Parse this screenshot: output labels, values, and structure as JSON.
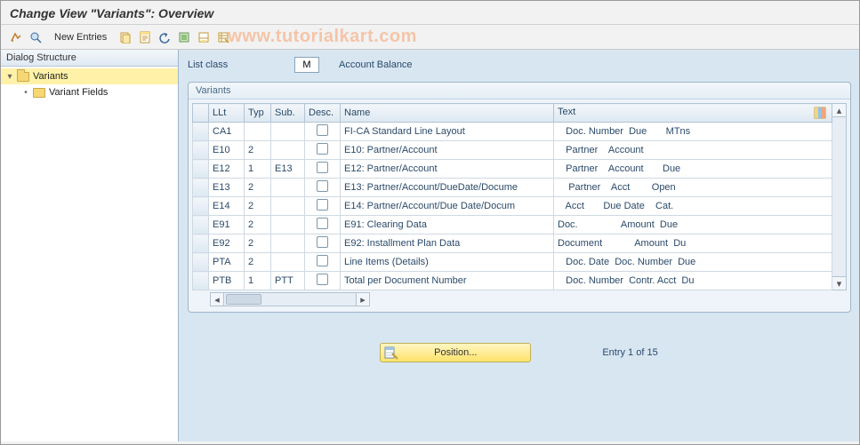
{
  "title": "Change View \"Variants\": Overview",
  "toolbar": {
    "new_entries": "New Entries"
  },
  "watermark": "www.tutorialkart.com",
  "sidebar": {
    "title": "Dialog Structure",
    "items": [
      {
        "label": "Variants",
        "level": 0,
        "expanded": true,
        "selected": true
      },
      {
        "label": "Variant Fields",
        "level": 1,
        "expanded": false,
        "selected": false
      }
    ]
  },
  "header_fields": {
    "list_class_label": "List class",
    "list_class_value": "M",
    "list_class_text": "Account Balance"
  },
  "panel": {
    "title": "Variants",
    "columns": {
      "llt": "LLt",
      "typ": "Typ",
      "sub": "Sub.",
      "desc": "Desc.",
      "name": "Name",
      "text": "Text"
    },
    "rows": [
      {
        "llt": "CA1",
        "typ": "",
        "sub": "",
        "name": "FI-CA Standard Line Layout",
        "text": "   Doc. Number  Due       MTns"
      },
      {
        "llt": "E10",
        "typ": "2",
        "sub": "",
        "name": "E10: Partner/Account",
        "text": "   Partner    Account"
      },
      {
        "llt": "E12",
        "typ": "1",
        "sub": "E13",
        "name": "E12: Partner/Account",
        "text": "   Partner    Account       Due"
      },
      {
        "llt": "E13",
        "typ": "2",
        "sub": "",
        "name": "E13: Partner/Account/DueDate/Docume",
        "text": "    Partner    Acct        Open"
      },
      {
        "llt": "E14",
        "typ": "2",
        "sub": "",
        "name": "E14: Partner/Account/Due Date/Docum",
        "text": "   Acct       Due Date    Cat."
      },
      {
        "llt": "E91",
        "typ": "2",
        "sub": "",
        "name": "E91: Clearing Data",
        "text": "Doc.                Amount  Due"
      },
      {
        "llt": "E92",
        "typ": "2",
        "sub": "",
        "name": "E92: Installment Plan Data",
        "text": "Document            Amount  Du"
      },
      {
        "llt": "PTA",
        "typ": "2",
        "sub": "",
        "name": "Line Items (Details)",
        "text": "   Doc. Date  Doc. Number  Due"
      },
      {
        "llt": "PTB",
        "typ": "1",
        "sub": "PTT",
        "name": "Total per Document Number",
        "text": "   Doc. Number  Contr. Acct  Du"
      }
    ]
  },
  "footer": {
    "position_button": "Position...",
    "entry_text": "Entry 1 of 15"
  }
}
